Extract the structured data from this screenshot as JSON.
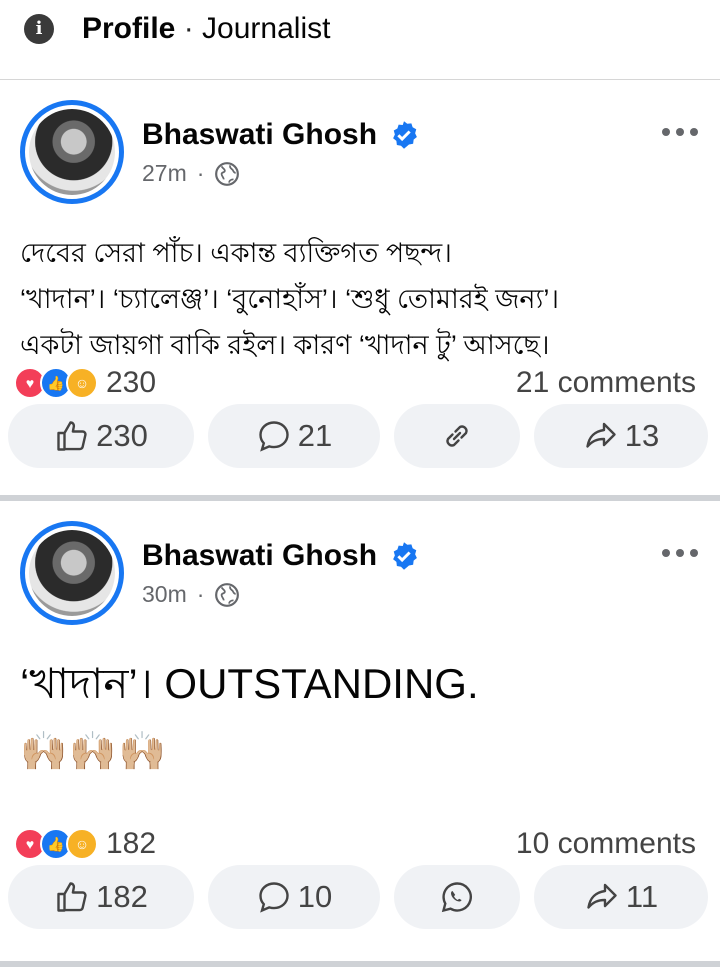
{
  "header": {
    "title": "Profile",
    "separator": "·",
    "subtitle": "Journalist",
    "info_icon": "i"
  },
  "posts": [
    {
      "author": "Bhaswati Ghosh",
      "time": "27m",
      "dot": "·",
      "text_lines": [
        "দেবের সেরা পাঁচ। একান্ত ব্যক্তিগত পছন্দ।",
        "‘খাদান’। ‘চ্যালেঞ্জ’। ‘বুনোহাঁস’। ‘শুধু তোমারই জন্য’।",
        "একটা জায়গা বাকি রইল। কারণ ‘খাদান টু’ আসছে।"
      ],
      "reactions": "230",
      "comments_label": "21 comments",
      "actions": {
        "like": "230",
        "comment": "21",
        "share": "13"
      }
    },
    {
      "author": "Bhaswati Ghosh",
      "time": "30m",
      "dot": "·",
      "text": "‘খাদান’। OUTSTANDING.",
      "emojis": "🙌🏼🙌🏼🙌🏼",
      "reactions": "182",
      "comments_label": "10 comments",
      "actions": {
        "like": "182",
        "comment": "10",
        "share": "11"
      }
    }
  ],
  "colors": {
    "accent": "#1877f2",
    "love": "#f33e58",
    "care": "#f7b125",
    "button_bg": "#f0f2f5",
    "muted": "#65676b"
  },
  "icons": [
    "info-icon",
    "verified-badge-icon",
    "globe-icon",
    "more-icon",
    "like-icon",
    "comment-icon",
    "link-icon",
    "whatsapp-icon",
    "share-icon"
  ]
}
